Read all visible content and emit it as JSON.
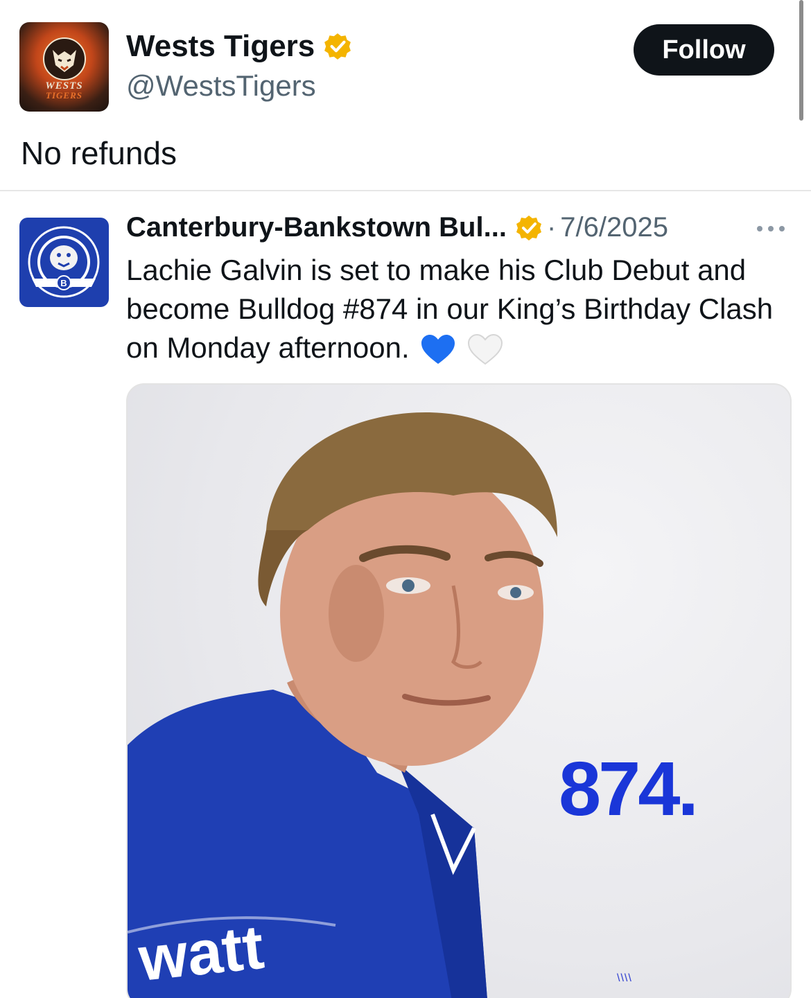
{
  "post": {
    "display_name": "Wests Tigers",
    "handle": "@WestsTigers",
    "follow_label": "Follow",
    "text": "No refunds",
    "avatar_text": [
      "WESTS",
      "TIGERS"
    ]
  },
  "quoted": {
    "display_name": "Canterbury-Bankstown Bul...",
    "separator": "·",
    "date": "7/6/2025",
    "text": "Lachie Galvin is set to make his Club Debut and become Bulldog #874 in our King’s Birthday Clash on Monday afternoon.",
    "avatar_text": [
      "CANTERBURY-BANKSTOWN BULLDOGS",
      "1935",
      "2025"
    ],
    "image": {
      "number": "874.",
      "jersey_text": "watt",
      "watermark": "\\\\\\\\"
    }
  },
  "icons": {
    "verified": "verified-badge-icon",
    "more": "more-icon",
    "hearts": [
      "blue-heart-icon",
      "white-heart-icon"
    ]
  },
  "colors": {
    "verified_gold": "#f4b400",
    "bulldogs_blue": "#1e3fae",
    "number_blue": "#1a36d8",
    "follow_bg": "#0f1419"
  }
}
